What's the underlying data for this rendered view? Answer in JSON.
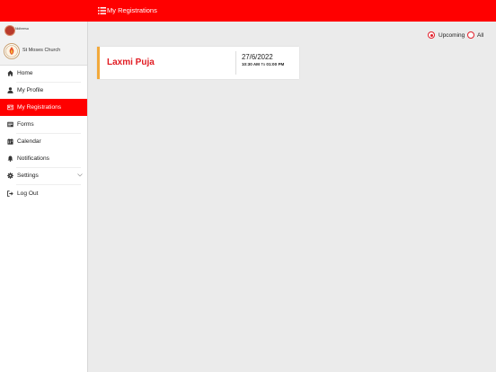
{
  "header": {
    "title": "My Registrations"
  },
  "sidebar": {
    "user_name": "Nidheesa",
    "church_name": "St Moses Church",
    "items": [
      {
        "label": "Home",
        "icon": "home-icon"
      },
      {
        "label": "My Profile",
        "icon": "user-icon"
      },
      {
        "label": "My Registrations",
        "icon": "registration-card-icon"
      },
      {
        "label": "Forms",
        "icon": "form-icon"
      },
      {
        "label": "Calendar",
        "icon": "calendar-icon"
      },
      {
        "label": "Notifications",
        "icon": "bell-icon"
      },
      {
        "label": "Settings",
        "icon": "gear-icon"
      },
      {
        "label": "Log Out",
        "icon": "logout-icon"
      }
    ]
  },
  "filter": {
    "options": [
      {
        "label": "Upcoming",
        "selected": true
      },
      {
        "label": "All",
        "selected": false
      }
    ]
  },
  "registrations": [
    {
      "event_name": "Laxmi Puja",
      "date": "27/6/2022",
      "start_time": "10:30 AM",
      "to_label": "To",
      "end_time": "01:00 PM"
    }
  ],
  "colors": {
    "primary": "#ff0000",
    "accent": "#f2a93b",
    "event_title": "#e11b22",
    "background": "#ebebeb"
  }
}
